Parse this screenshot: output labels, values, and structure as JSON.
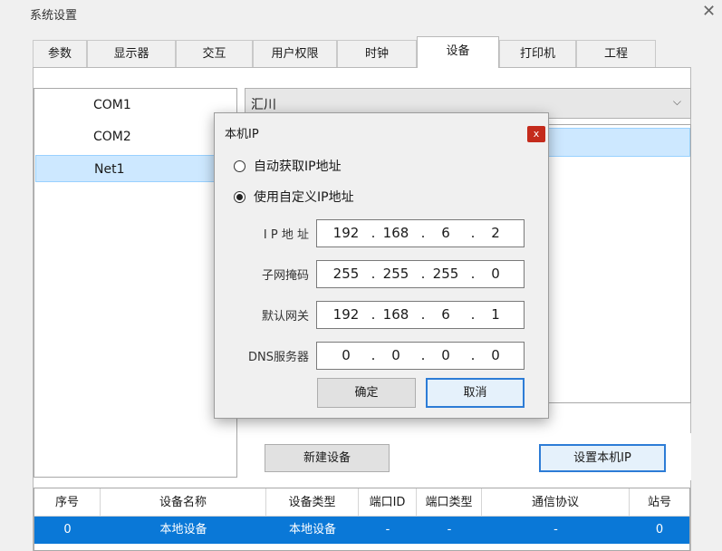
{
  "window": {
    "title": "系统设置",
    "close_glyph": "✕"
  },
  "tabs": [
    {
      "label": "参数"
    },
    {
      "label": "显示器"
    },
    {
      "label": "交互"
    },
    {
      "label": "用户权限"
    },
    {
      "label": "时钟"
    },
    {
      "label": "设备"
    },
    {
      "label": "打印机"
    },
    {
      "label": "工程"
    }
  ],
  "active_tab": "设备",
  "ports": [
    {
      "label": "COM1"
    },
    {
      "label": "COM2"
    },
    {
      "label": "Net1"
    }
  ],
  "selected_port": "Net1",
  "vendor_select": {
    "value": "汇川",
    "caret": "⌵"
  },
  "buttons": {
    "new_device": "新建设备",
    "set_local_ip": "设置本机IP"
  },
  "table": {
    "headers": [
      "序号",
      "设备名称",
      "设备类型",
      "端口ID",
      "端口类型",
      "通信协议",
      "站号"
    ],
    "rows": [
      [
        "0",
        "本地设备",
        "本地设备",
        "-",
        "-",
        "-",
        "0"
      ]
    ]
  },
  "dialog": {
    "title": "本机IP",
    "close_glyph": "x",
    "radio_auto": "自动获取IP地址",
    "radio_custom": "使用自定义IP地址",
    "selected_mode": "custom",
    "fields": [
      {
        "label": "I P 地 址",
        "octets": [
          "192",
          "168",
          "6",
          "2"
        ]
      },
      {
        "label": "子网掩码",
        "octets": [
          "255",
          "255",
          "255",
          "0"
        ]
      },
      {
        "label": "默认网关",
        "octets": [
          "192",
          "168",
          "6",
          "1"
        ]
      },
      {
        "label": "DNS服务器",
        "octets": [
          "0",
          "0",
          "0",
          "0"
        ]
      }
    ],
    "ok_label": "确定",
    "cancel_label": "取消"
  },
  "colors": {
    "accent": "#0a78d7",
    "selection": "#cde8ff",
    "close_red": "#c42b1c",
    "focus_border": "#2d7cd6"
  }
}
